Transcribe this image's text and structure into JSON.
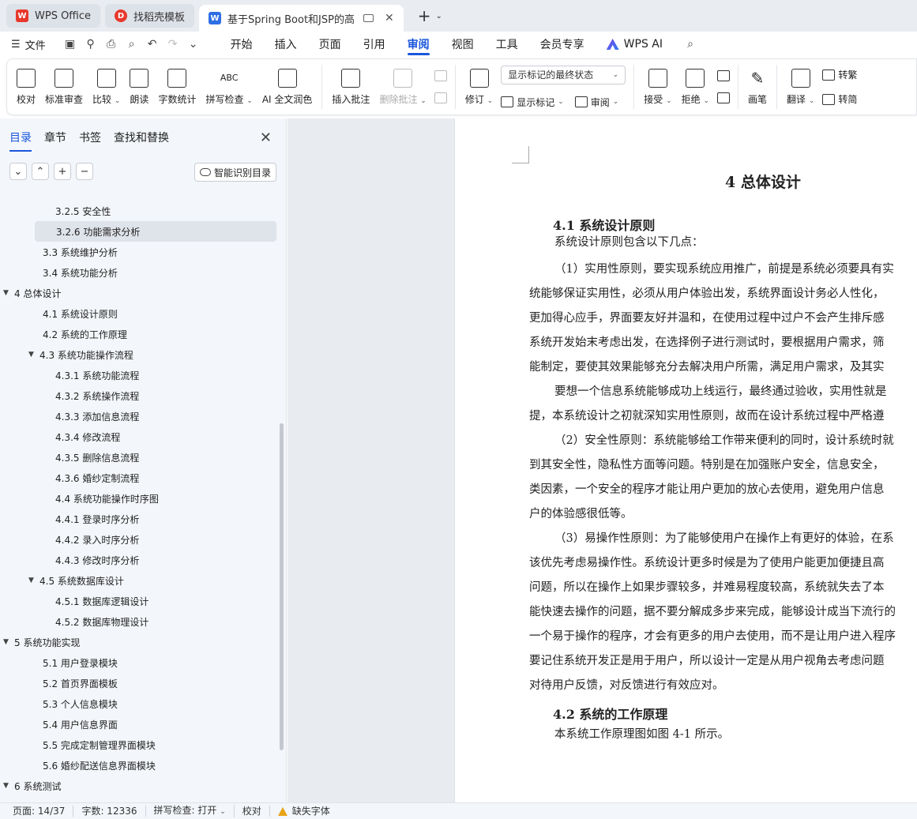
{
  "tabs": [
    {
      "label": "WPS Office",
      "logo": "W",
      "color": "#e8372c"
    },
    {
      "label": "找稻壳模板",
      "logo": "D",
      "color": "#e8372c"
    },
    {
      "label": "基于Spring Boot和JSP的高级",
      "logo": "W",
      "color": "#2f6fe4"
    }
  ],
  "menu": {
    "file": "文件",
    "items": [
      "开始",
      "插入",
      "页面",
      "引用",
      "审阅",
      "视图",
      "工具",
      "会员专享"
    ],
    "active": "审阅",
    "ai": "WPS AI"
  },
  "ribbon": {
    "proof": "校对",
    "standard_review": "标准审查",
    "compare": "比较",
    "read_aloud": "朗读",
    "word_count": "字数统计",
    "spell_check": "拼写检查",
    "ai_polish": "AI 全文润色",
    "insert_comment": "插入批注",
    "delete_comment": "删除批注",
    "revise": "修订",
    "markup_dropdown": "显示标记的最终状态",
    "show_markup": "显示标记",
    "review": "审阅",
    "accept": "接受",
    "reject": "拒绝",
    "pen": "画笔",
    "translate": "翻译",
    "to_traditional": "转繁",
    "to_simplified": "转简"
  },
  "panel": {
    "tabs": [
      "目录",
      "章节",
      "书签",
      "查找和替换"
    ],
    "smart_button": "智能识别目录",
    "toc": [
      {
        "level": 3,
        "text": "3.2.5  安全性"
      },
      {
        "level": 3,
        "text": "3.2.6  功能需求分析",
        "selected": true
      },
      {
        "level": 2,
        "text": "3.3  系统维护分析"
      },
      {
        "level": 2,
        "text": "3.4  系统功能分析"
      },
      {
        "level": 1,
        "text": "4  总体设计",
        "expanded": true
      },
      {
        "level": 2,
        "text": "4.1 系统设计原则"
      },
      {
        "level": 2,
        "text": "4.2 系统的工作原理"
      },
      {
        "level": 2,
        "text": "4.3 系统功能操作流程",
        "expanded": true
      },
      {
        "level": 3,
        "text": "4.3.1 系统功能流程"
      },
      {
        "level": 3,
        "text": "4.3.2 系统操作流程"
      },
      {
        "level": 3,
        "text": "4.3.3 添加信息流程"
      },
      {
        "level": 3,
        "text": "4.3.4 修改流程"
      },
      {
        "level": 3,
        "text": "4.3.5 删除信息流程"
      },
      {
        "level": 3,
        "text": "4.3.6 婚纱定制流程"
      },
      {
        "level": 3,
        "text": "4.4 系统功能操作时序图"
      },
      {
        "level": 3,
        "text": "4.4.1 登录时序分析"
      },
      {
        "level": 3,
        "text": "4.4.2 录入时序分析"
      },
      {
        "level": 3,
        "text": "4.4.3 修改时序分析"
      },
      {
        "level": 2,
        "text": "4.5 系统数据库设计",
        "expanded": true
      },
      {
        "level": 3,
        "text": "4.5.1 数据库逻辑设计"
      },
      {
        "level": 3,
        "text": "4.5.2 数据库物理设计"
      },
      {
        "level": 1,
        "text": "5  系统功能实现",
        "expanded": true
      },
      {
        "level": 2,
        "text": "5.1  用户登录模块"
      },
      {
        "level": 2,
        "text": "5.2  首页界面模板"
      },
      {
        "level": 2,
        "text": "5.3  个人信息模块"
      },
      {
        "level": 2,
        "text": "5.4  用户信息界面"
      },
      {
        "level": 2,
        "text": "5.5  完成定制管理界面模块"
      },
      {
        "level": 2,
        "text": "5.6  婚纱配送信息界面模块"
      },
      {
        "level": 1,
        "text": "6 系统测试",
        "expanded": true
      }
    ]
  },
  "document": {
    "chapter": "4  总体设计",
    "h41": "4.1 系统设计原则",
    "lines": [
      "系统设计原则包含以下几点：",
      "（1）实用性原则，要实现系统应用推广，前提是系统必须要具有实",
      "统能够保证实用性，必须从用户体验出发，系统界面设计务必人性化，",
      "更加得心应手，界面要友好并温和，在使用过程中过户不会产生排斥感",
      "系统开发始末考虑出发，在选择例子进行测试时，要根据用户需求，筛",
      "能制定，要使其效果能够充分去解决用户所需，满足用户需求，及其实",
      "要想一个信息系统能够成功上线运行，最终通过验收，实用性就是",
      "提，本系统设计之初就深知实用性原则，故而在设计系统过程中严格遵",
      "（2）安全性原则：系统能够给工作带来便利的同时，设计系统时就",
      "到其安全性，隐私性方面等问题。特别是在加强账户安全，信息安全，",
      "类因素，一个安全的程序才能让用户更加的放心去使用，避免用户信息",
      "户的体验感很低等。",
      "（3）易操作性原则：为了能够使用户在操作上有更好的体验，在系",
      "该优先考虑易操作性。系统设计更多时候是为了使用户能更加便捷且高",
      "问题，所以在操作上如果步骤较多，并难易程度较高，系统就失去了本",
      "能快速去操作的问题，据不要分解成多步来完成，能够设计成当下流行的",
      "一个易于操作的程序，才会有更多的用户去使用，而不是让用户进入程序",
      "要记住系统开发正是用于用户，所以设计一定是从用户视角去考虑问题",
      "对待用户反馈，对反馈进行有效应对。"
    ],
    "h42": "4.2 系统的工作原理",
    "last_line": "本系统工作原理图如图 4-1 所示。"
  },
  "status": {
    "page": "页面: 14/37",
    "words": "字数: 12336",
    "spell": "拼写检查: 打开",
    "proof": "校对",
    "missing_font": "缺失字体"
  }
}
